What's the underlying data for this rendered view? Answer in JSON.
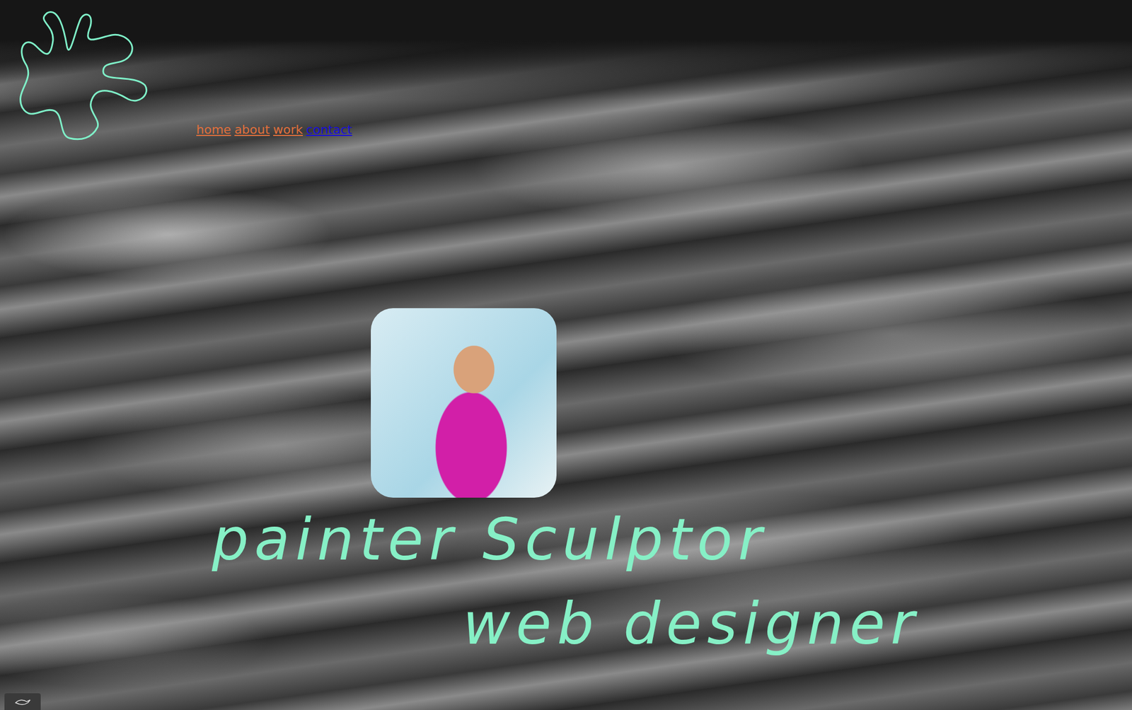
{
  "site": {
    "nav": [
      {
        "label": "home",
        "color": "#e0703c"
      },
      {
        "label": "about",
        "color": "#e0703c"
      },
      {
        "label": "work",
        "color": "#e0703c"
      },
      {
        "label": "contact",
        "color": "#1a10d8"
      }
    ]
  },
  "hero": {
    "lines": [
      "painter Sculptor",
      "web designer"
    ]
  }
}
